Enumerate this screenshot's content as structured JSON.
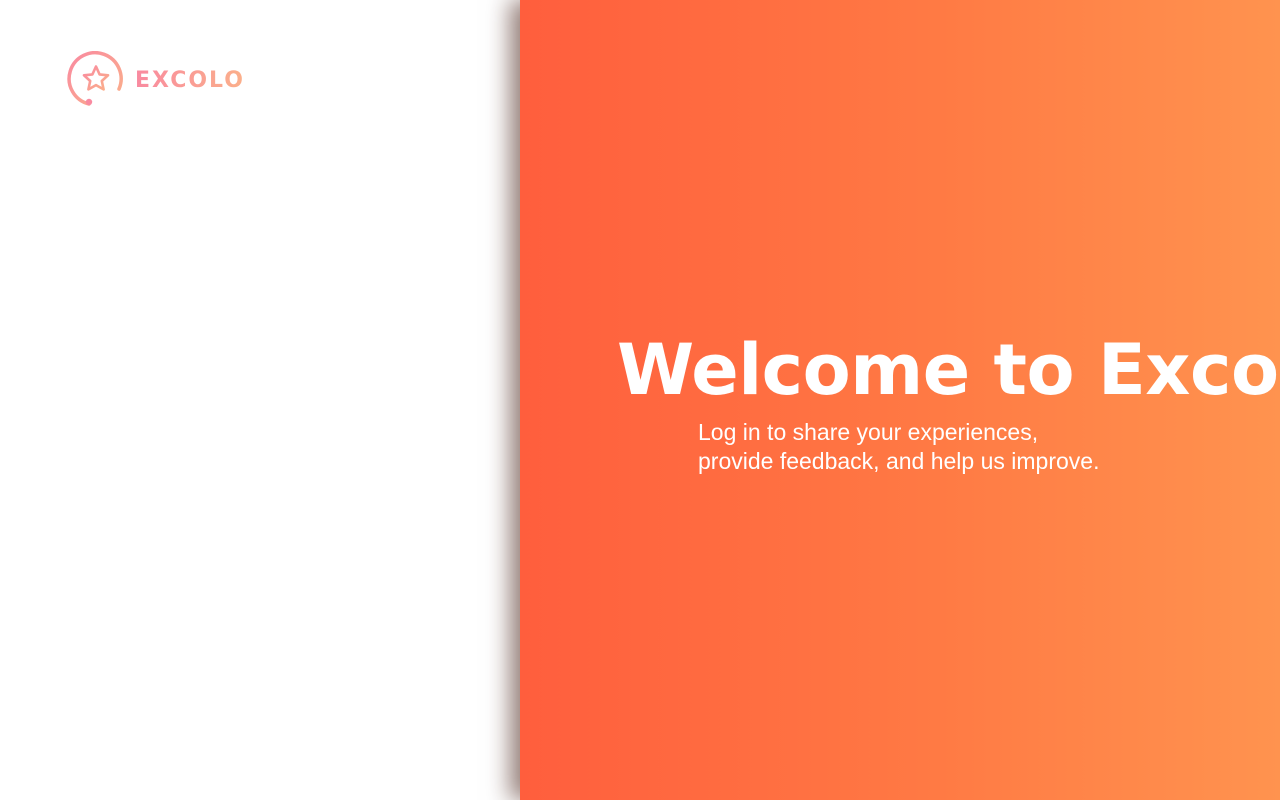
{
  "brand": {
    "name": "EXCOLO",
    "logo_icon": "star-in-circle-icon",
    "colors": {
      "logo_gradient_start": "#f98aa0",
      "logo_gradient_end": "#fbb08a"
    }
  },
  "hero": {
    "title": "Welcome to Excolo",
    "subtitle_line1": "Log in to share your experiences,",
    "subtitle_line2": "provide feedback, and help us improve."
  },
  "theme": {
    "panel_gradient_start": "#ff5e3d",
    "panel_gradient_end": "#ff934f",
    "text_on_panel": "#ffffff"
  }
}
